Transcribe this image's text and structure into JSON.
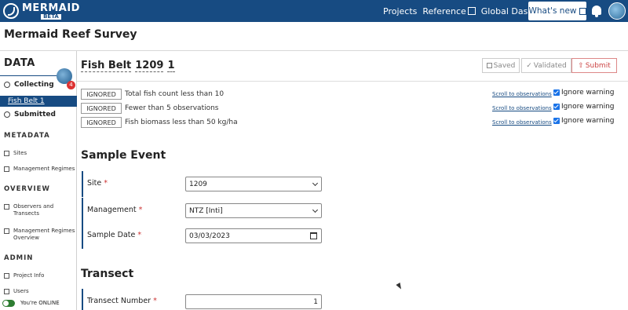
{
  "brand": {
    "name": "MERMAID",
    "beta": "BETA"
  },
  "topnav": {
    "projects": "Projects",
    "reference": "Reference",
    "global_dashboard": "Global Dashboard",
    "whats_new": "What's new"
  },
  "project": {
    "title": "Mermaid Reef Survey"
  },
  "sidebar": {
    "data_heading": "DATA",
    "badge": "4",
    "collecting": "Collecting",
    "selected_record": "Fish Belt 1",
    "submitted": "Submitted",
    "metadata_heading": "METADATA",
    "sites": "Sites",
    "management_regimes": "Management Regimes",
    "overview_heading": "OVERVIEW",
    "observers_transects": "Observers and Transects",
    "management_regimes_overview": "Management Regimes Overview",
    "admin_heading": "ADMIN",
    "project_info": "Project Info",
    "users": "Users",
    "online_status": "You're ONLINE"
  },
  "record": {
    "protocol": "Fish Belt",
    "site": "1209",
    "number": "1",
    "status": {
      "saved": "Saved",
      "validated": "Validated",
      "submit": "Submit"
    }
  },
  "warnings": [
    {
      "tag": "IGNORED",
      "message": "Total fish count less than 10",
      "link": "Scroll to observations",
      "checkbox": "Ignore warning"
    },
    {
      "tag": "IGNORED",
      "message": "Fewer than 5 observations",
      "link": "Scroll to observations",
      "checkbox": "Ignore warning"
    },
    {
      "tag": "IGNORED",
      "message": "Fish biomass less than 50 kg/ha",
      "link": "Scroll to observations",
      "checkbox": "Ignore warning"
    }
  ],
  "sample_event": {
    "title": "Sample Event",
    "site_label": "Site",
    "site_value": "1209",
    "management_label": "Management",
    "management_value": "NTZ [Inti]",
    "date_label": "Sample Date",
    "date_value": "03/03/2023"
  },
  "transect": {
    "title": "Transect",
    "number_label": "Transect Number",
    "number_value": "1"
  },
  "colors": {
    "brand": "#174b82",
    "required": "#cc3333",
    "submit": "#cc4444"
  }
}
